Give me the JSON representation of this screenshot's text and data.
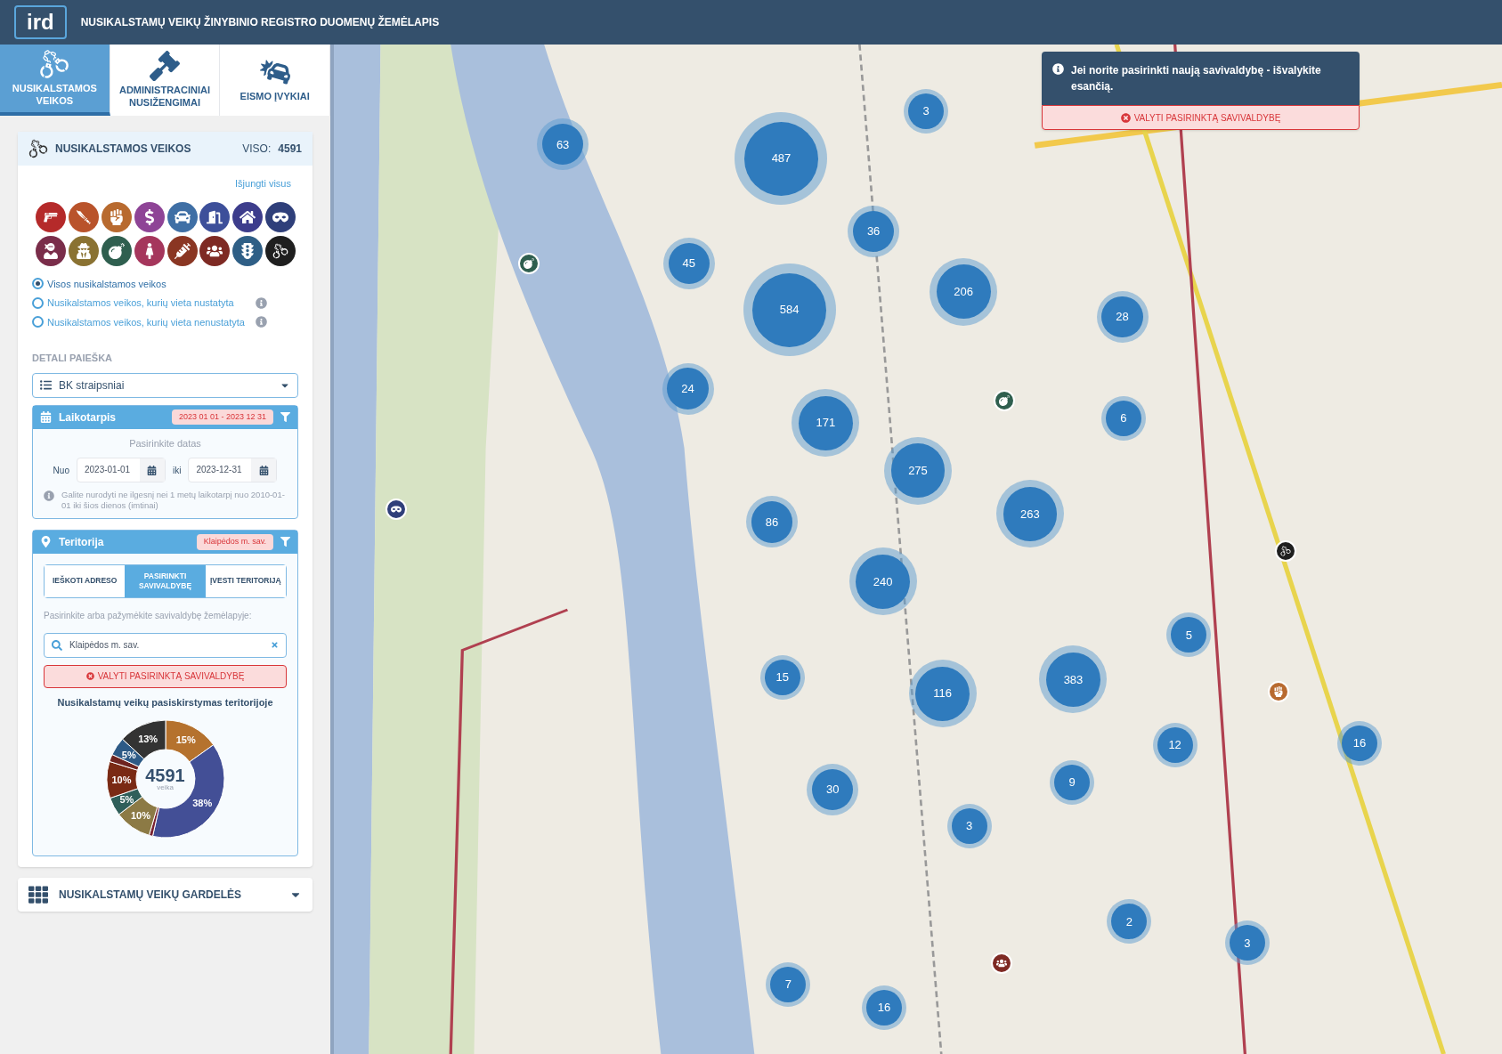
{
  "header": {
    "logo": "ird",
    "title": "NUSIKALSTAMŲ VEIKŲ ŽINYBINIO REGISTRO DUOMENŲ ŽEMĖLAPIS"
  },
  "tabs": [
    {
      "label": "NUSIKALSTAMOS VEIKOS",
      "selected": true,
      "kind": "handcuffs"
    },
    {
      "label": "ADMINISTRACINIAI NUSIŽENGIMAI",
      "selected": false,
      "kind": "gavel"
    },
    {
      "label": "EISMO ĮVYKIAI",
      "selected": false,
      "kind": "crash"
    }
  ],
  "crimes_panel": {
    "title": "NUSIKALSTAMOS VEIKOS",
    "total_label": "VISO:",
    "total": "4591",
    "toggle_all_link": "Išjungti visus",
    "categories": [
      {
        "kind": "gun",
        "color": "#b52a2a"
      },
      {
        "kind": "knife",
        "color": "#b9532b"
      },
      {
        "kind": "fist",
        "color": "#b86a2f"
      },
      {
        "kind": "money",
        "color": "#8e4496"
      },
      {
        "kind": "car",
        "color": "#3f6fa5"
      },
      {
        "kind": "burglary",
        "color": "#3d4f9a"
      },
      {
        "kind": "home",
        "color": "#3d3d8c"
      },
      {
        "kind": "mask",
        "color": "#2f3f7a"
      },
      {
        "kind": "balaclava",
        "color": "#7a2d4a"
      },
      {
        "kind": "spy",
        "color": "#8a7232"
      },
      {
        "kind": "bomb",
        "color": "#2f5f4f"
      },
      {
        "kind": "dancer",
        "color": "#a5365c"
      },
      {
        "kind": "syringe",
        "color": "#8a3623"
      },
      {
        "kind": "protest",
        "color": "#7e2a24"
      },
      {
        "kind": "traffic",
        "color": "#2f5f86"
      },
      {
        "kind": "handcuffs",
        "color": "#1f1f1f"
      }
    ],
    "radios": [
      {
        "label": "Visos nusikalstamos veikos",
        "selected": true,
        "info": false
      },
      {
        "label": "Nusikalstamos veikos, kurių vieta nustatyta",
        "selected": false,
        "info": true
      },
      {
        "label": "Nusikalstamos veikos, kurių vieta nenustatyta",
        "selected": false,
        "info": true
      }
    ],
    "detail_heading": "DETALI PAIEŠKA",
    "detail_select": "BK straipsniai"
  },
  "period": {
    "title": "Laikotarpis",
    "badge": "2023 01 01 - 2023 12 31",
    "prompt": "Pasirinkite datas",
    "from_label": "Nuo",
    "from_value": "2023-01-01",
    "to_label": "iki",
    "to_value": "2023-12-31",
    "note": "Galite nurodyti ne ilgesnį nei 1 metų laikotarpį nuo 2010-01-01 iki šios dienos (imtinai)"
  },
  "territory": {
    "title": "Teritorija",
    "badge": "Klaipėdos m. sav.",
    "tabs": [
      {
        "label": "IEŠKOTI ADRESO",
        "selected": false
      },
      {
        "label": "PASIRINKTI SAVIVALDYBĘ",
        "selected": true
      },
      {
        "label": "ĮVESTI TERITORIJĄ",
        "selected": false
      }
    ],
    "prompt": "Pasirinkite arba pažymėkite savivaldybę žemėlapyje:",
    "search_value": "Klaipėdos m. sav.",
    "clear_button": "VALYTI PASIRINKTĄ SAVIVALDYBĘ",
    "chart_title": "Nusikalstamų veikų pasiskirstymas teritorijoje",
    "center_value": "4591",
    "center_label": "veika",
    "chart_data": {
      "type": "donut",
      "values": [
        15,
        38,
        1,
        10,
        5,
        10,
        2,
        5,
        13
      ],
      "value_labels": [
        "15%",
        "38%",
        null,
        "10%",
        "5%",
        "10%",
        null,
        "5%",
        "13%"
      ]
    }
  },
  "grid_panel": {
    "title": "NUSIKALSTAMŲ VEIKŲ GARDELĖS",
    "expanded": false
  },
  "notification": {
    "message": "Jei norite pasirinkti naują savivaldybę - išvalykite esančią.",
    "clear_button": "VALYTI PASIRINKTĄ SAVIVALDYBĘ"
  },
  "map": {
    "clusters": [
      {
        "count": "63"
      },
      {
        "count": "487"
      },
      {
        "count": "3"
      },
      {
        "count": "36"
      },
      {
        "count": "45"
      },
      {
        "count": "584"
      },
      {
        "count": "206"
      },
      {
        "count": "28"
      },
      {
        "count": "24"
      },
      {
        "count": "171"
      },
      {
        "count": "6"
      },
      {
        "count": "275"
      },
      {
        "count": "263"
      },
      {
        "count": "86"
      },
      {
        "count": "240"
      },
      {
        "count": "5"
      },
      {
        "count": "15"
      },
      {
        "count": "116"
      },
      {
        "count": "383"
      },
      {
        "count": "12"
      },
      {
        "count": "16"
      },
      {
        "count": "9"
      },
      {
        "count": "30"
      },
      {
        "count": "3"
      },
      {
        "count": "2"
      },
      {
        "count": "3"
      },
      {
        "count": "7"
      },
      {
        "count": "16"
      }
    ],
    "markers": [
      {
        "kind": "bomb",
        "color": "#2f5f4f"
      },
      {
        "kind": "mask",
        "color": "#2f3f7a"
      },
      {
        "kind": "bomb",
        "color": "#2f5f4f"
      },
      {
        "kind": "handcuffs",
        "color": "#1f1f1f"
      },
      {
        "kind": "fist",
        "color": "#b86a2f"
      },
      {
        "kind": "protest",
        "color": "#7e2a24"
      }
    ]
  }
}
